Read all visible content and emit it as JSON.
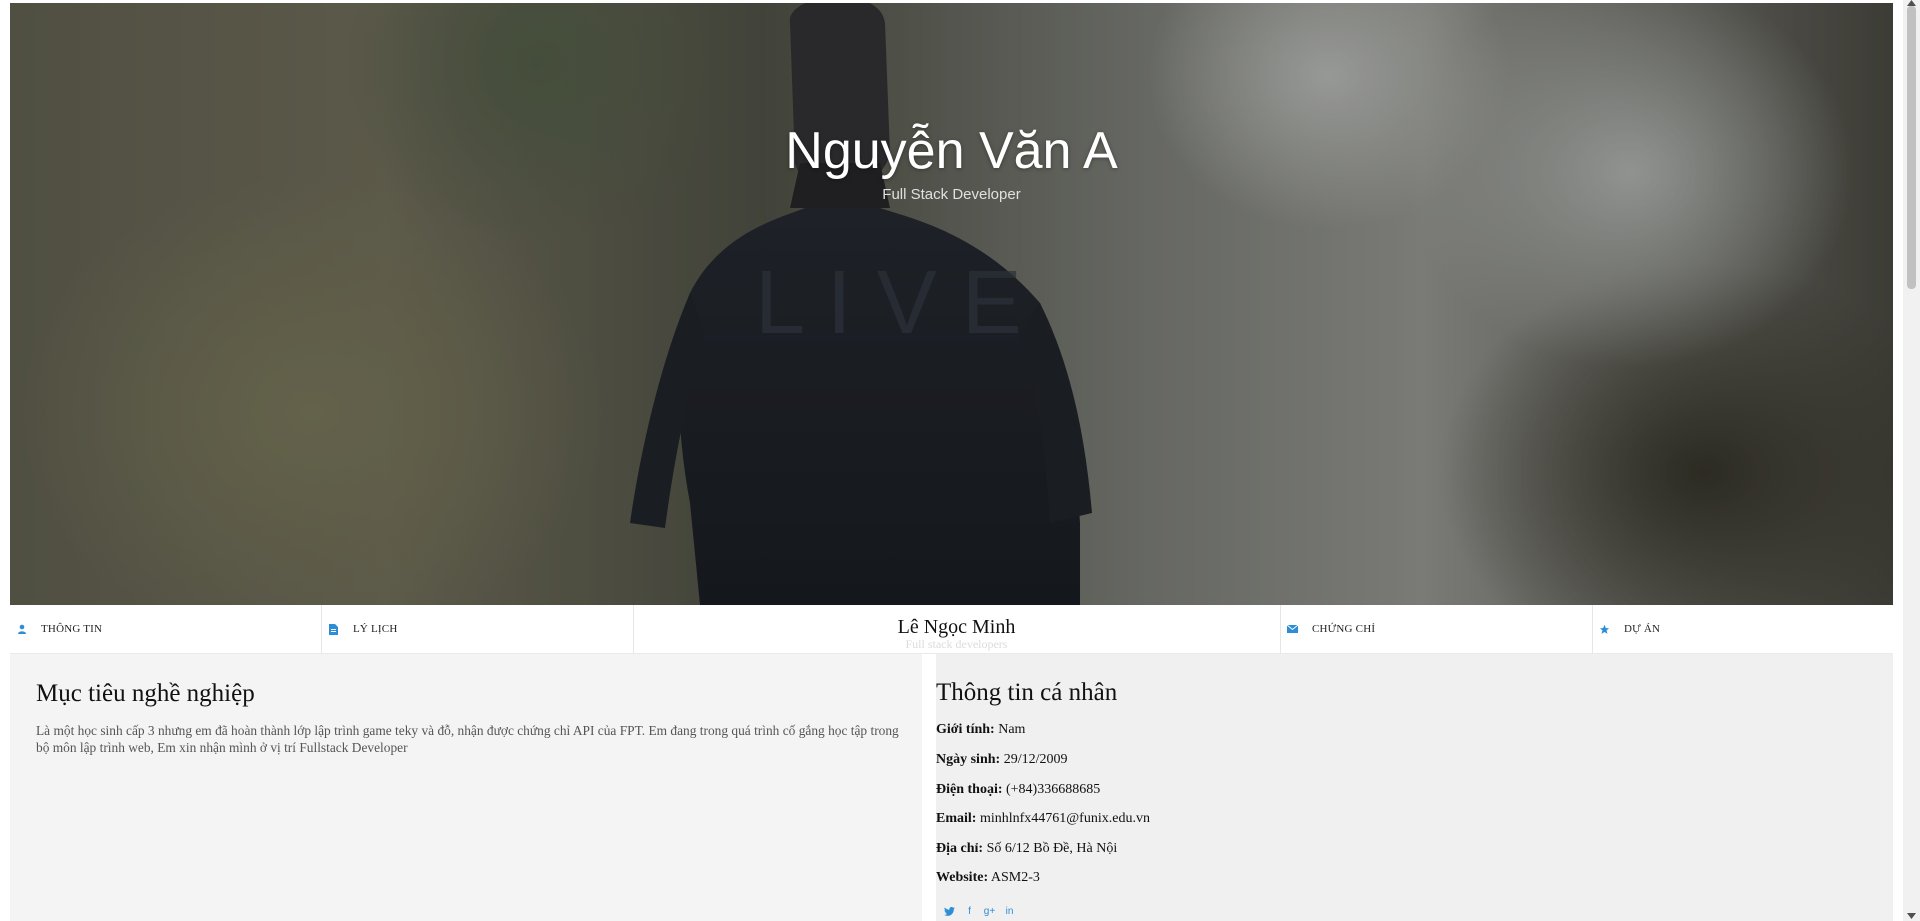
{
  "hero": {
    "name": "Nguyễn Văn A",
    "role": "Full Stack Developer"
  },
  "nav": {
    "items": [
      {
        "label": "THÔNG TIN",
        "icon": "user-icon"
      },
      {
        "label": "LÝ LỊCH",
        "icon": "document-icon"
      },
      {
        "label": "CHỨNG CHỈ",
        "icon": "envelope-icon"
      },
      {
        "label": "DỰ ÁN",
        "icon": "star-icon"
      }
    ],
    "brand": "Lê Ngọc Minh",
    "brand_sub": "Full stack developers"
  },
  "objective": {
    "title": "Mục tiêu nghề nghiệp",
    "text": "Là một học sinh cấp 3 nhưng em đã hoàn thành lớp lập trình game teky và đỗ, nhận được chứng chỉ API của FPT. Em đang trong quá trình cố gắng học tập trong bộ môn lập trình web, Em xin nhận mình ở vị trí Fullstack Developer"
  },
  "personal": {
    "title": "Thông tin cá nhân",
    "fields": [
      {
        "label": "Giới tính:",
        "value": "Nam"
      },
      {
        "label": "Ngày sinh:",
        "value": "29/12/2009"
      },
      {
        "label": "Điện thoại:",
        "value": "(+84)336688685"
      },
      {
        "label": "Email:",
        "value": "minhlnfx44761@funix.edu.vn"
      },
      {
        "label": "Địa chỉ:",
        "value": "Số 6/12 Bồ Đề, Hà Nội"
      },
      {
        "label": "Website:",
        "value": "ASM2-3"
      }
    ],
    "socials": [
      "twitter-icon",
      "facebook-icon",
      "google-plus-icon",
      "linkedin-icon"
    ]
  },
  "colors": {
    "accent": "#2d8dd6",
    "left_bg": "#f4f4f4",
    "right_bg": "#f0f0f0"
  }
}
